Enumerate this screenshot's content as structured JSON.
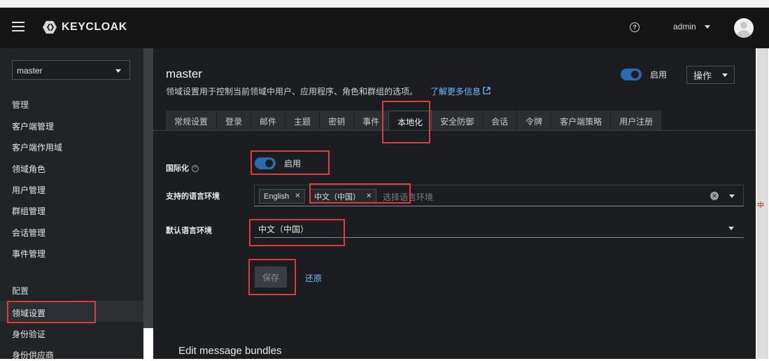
{
  "header": {
    "brand": "KEYCLOAK",
    "help_icon": "help-icon",
    "user": "admin"
  },
  "sidebar": {
    "realm": "master",
    "group_manage": "管理",
    "manage_items": [
      "客户端管理",
      "客户端作用域",
      "领域角色",
      "用户管理",
      "群组管理",
      "会话管理",
      "事件管理"
    ],
    "group_configure": "配置",
    "configure_items": [
      "领域设置",
      "身份验证",
      "身份供应商"
    ]
  },
  "main": {
    "title": "master",
    "description": "领域设置用于控制当前领域中用户、应用程序、角色和群组的选项。",
    "learn_more": "了解更多信息",
    "enabled_label": "启用",
    "action": "操作",
    "tabs": [
      "常规设置",
      "登录",
      "邮件",
      "主题",
      "密钥",
      "事件",
      "本地化",
      "安全防御",
      "会话",
      "令牌",
      "客户端策略",
      "用户注册"
    ],
    "active_tab": "本地化",
    "form": {
      "i18n_label": "国际化",
      "i18n_value": "启用",
      "supported_label": "支持的语言环境",
      "supported_chips": [
        "English",
        "中文（中国）"
      ],
      "supported_placeholder": "选择语言环境",
      "default_label": "默认语言环境",
      "default_value": "中文（中国）",
      "save": "保存",
      "revert": "还原"
    },
    "bundles_title": "Edit message bundles"
  },
  "side_text": "中",
  "colors": {
    "accent": "#73bcf7",
    "toggle": "#2b6cb0",
    "annotation": "#e03a3e",
    "masthead": "#151515",
    "sidebar": "#212427",
    "main": "#1b1d21"
  }
}
